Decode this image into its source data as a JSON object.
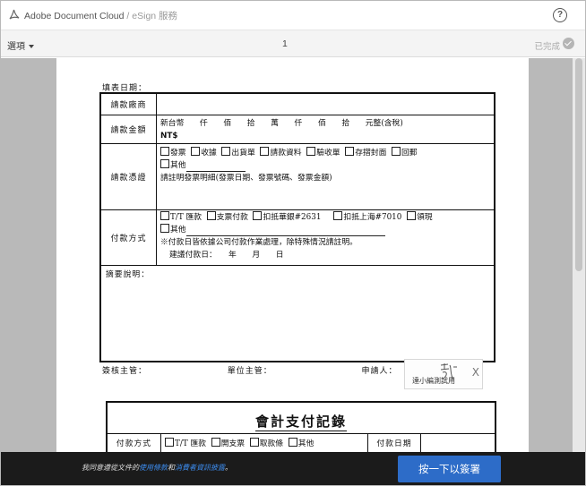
{
  "app": {
    "brand": "Adobe Document Cloud",
    "separator": "/",
    "service": "eSign 服務",
    "help_label": "?"
  },
  "toolbar": {
    "options_label": "選項",
    "page_number": "1",
    "done_label": "已完成"
  },
  "form": {
    "fill_date_label": "填表日期：",
    "rows": {
      "vendor": {
        "label": "請款廠商"
      },
      "amount": {
        "label": "請款金額",
        "line1": "新台幣　　仟　　佰　　拾　　萬　　仟　　佰　　拾　　元整(含稅)",
        "line2": "NT$"
      },
      "voucher": {
        "label": "請款憑證",
        "options": [
          "發票",
          "收據",
          "出貨單",
          "請款資料",
          "驗收單",
          "存摺封面",
          "回郵"
        ],
        "other_label": "其他",
        "note": "請註明發票明細(發票日期、發票號碼、發票金額)"
      },
      "payment": {
        "label": "付款方式",
        "options": [
          "T/T 匯款",
          "支票付款",
          "扣抵華銀#2631",
          "扣抵上海#7010",
          "領現"
        ],
        "other_label": "其他",
        "note1": "※付款日皆依據公司付款作業處理，除特殊情況請註明。",
        "note2": "建議付款日：　　年　　月　　日"
      },
      "summary": {
        "label": "摘要說明："
      }
    },
    "signatures": {
      "reviewer": "簽核主管：",
      "unit_head": "單位主管：",
      "applicant": "申請人："
    },
    "signature_box": {
      "caption": "達小編測試用",
      "clear_label": "X"
    }
  },
  "record": {
    "title": "會計支付記錄",
    "pay_method_label": "付款方式",
    "options": [
      "T/T 匯款",
      "開支票",
      "取款條",
      "其他"
    ],
    "pay_date_label": "付款日期"
  },
  "footer": {
    "agree_prefix": "我同意遵從文件的",
    "terms_link": "使用條款",
    "agree_and": "和",
    "privacy_link": "消費者資訊披露",
    "agree_suffix": "。",
    "cta_label": "按一下以簽署"
  },
  "colors": {
    "cta_blue": "#2d6cc8",
    "link_blue": "#3d8df0",
    "viewer_gray": "#b9b9b9",
    "footer_dark": "#1b1b1b"
  }
}
